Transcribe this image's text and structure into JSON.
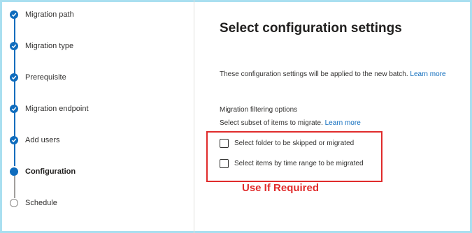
{
  "stepper": {
    "steps": [
      {
        "label": "Migration path",
        "state": "completed"
      },
      {
        "label": "Migration type",
        "state": "completed"
      },
      {
        "label": "Prerequisite",
        "state": "completed"
      },
      {
        "label": "Migration endpoint",
        "state": "completed"
      },
      {
        "label": "Add users",
        "state": "completed"
      },
      {
        "label": "Configuration",
        "state": "current"
      },
      {
        "label": "Schedule",
        "state": "pending"
      }
    ]
  },
  "main": {
    "title": "Select configuration settings",
    "description": "These configuration settings will be applied to the new batch.",
    "description_link": "Learn more",
    "filtering": {
      "title": "Migration filtering options",
      "subtitle": "Select subset of items to migrate.",
      "subtitle_link": "Learn more",
      "options": [
        {
          "label": "Select folder to be skipped or migrated",
          "checked": false
        },
        {
          "label": "Select items by time range to be migrated",
          "checked": false
        }
      ]
    }
  },
  "annotation": {
    "text": "Use If Required",
    "color": "#e02b2b"
  },
  "colors": {
    "accent": "#0f6cbd",
    "frame": "#a9dff0"
  }
}
